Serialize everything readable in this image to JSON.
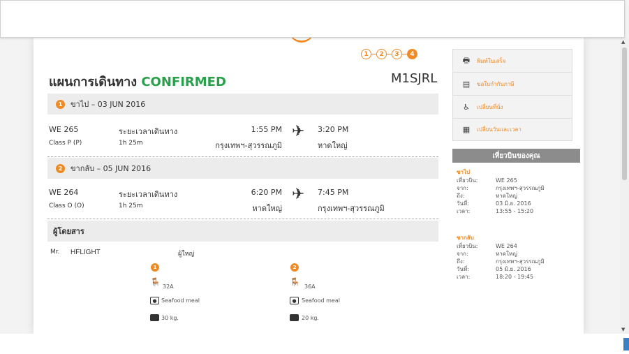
{
  "steps": [
    "1",
    "2",
    "3",
    "4"
  ],
  "header": {
    "title_prefix": "แผนการเดินทาง",
    "title_status": "CONFIRMED",
    "pnr": "M1SJRL"
  },
  "outbound": {
    "number": "1",
    "heading": "ขาไป – 03 JUN 2016",
    "flight": "WE 265",
    "class": "Class P (P)",
    "duration_label": "ระยะเวลาเดินทาง",
    "duration": "1h 25m",
    "depart_time": "1:55 PM",
    "depart_city": "กรุงเทพฯ-สุวรรณภูมิ",
    "arrive_time": "3:20 PM",
    "arrive_city": "หาดใหญ่"
  },
  "return": {
    "number": "2",
    "heading": "ขากลับ – 05 JUN 2016",
    "flight": "WE 264",
    "class": "Class O (O)",
    "duration_label": "ระยะเวลาเดินทาง",
    "duration": "1h 25m",
    "depart_time": "6:20 PM",
    "depart_city": "หาดใหญ่",
    "arrive_time": "7:45 PM",
    "arrive_city": "กรุงเทพฯ-สุวรรณภูมิ"
  },
  "passengers": {
    "heading": "ผู้โดยสาร",
    "list": [
      {
        "title": "Mr.",
        "name": "HFLIGHT",
        "type": "ผู้ใหญ่",
        "segments": [
          {
            "num": "1",
            "seat": "32A",
            "meal": "Seafood meal",
            "baggage": "30 kg."
          },
          {
            "num": "2",
            "seat": "36A",
            "meal": "Seafood meal",
            "baggage": "20 kg."
          }
        ]
      }
    ]
  },
  "menu": [
    {
      "icon": "printer-icon",
      "label": "พิมพ์ใบเสร็จ"
    },
    {
      "icon": "receipt-icon",
      "label": "ขอใบกำกับภาษี"
    },
    {
      "icon": "seat-icon",
      "label": "เปลี่ยนที่นั่ง"
    },
    {
      "icon": "calendar-icon",
      "label": "เปลี่ยนวันและเวลา"
    }
  ],
  "your_trip": {
    "heading": "เที่ยวบินของคุณ",
    "labels": {
      "flight": "เที่ยวบิน:",
      "from": "จาก:",
      "to": "ถึง:",
      "date": "วันที่:",
      "time": "เวลา:"
    },
    "outbound": {
      "heading": "ขาไป",
      "flight": "WE 265",
      "from": "กรุงเทพฯ-สุวรรณภูมิ",
      "to": "หาดใหญ่",
      "date": "03 มิ.ย. 2016",
      "time": "13:55 - 15:20"
    },
    "return": {
      "heading": "ขากลับ",
      "flight": "WE 264",
      "from": "หาดใหญ่",
      "to": "กรุงเทพฯ-สุวรรณภูมิ",
      "date": "05 มิ.ย. 2016",
      "time": "18:20 - 19:45"
    }
  },
  "colors": {
    "accent": "#f08a24",
    "confirmed": "#27a14a",
    "sidebar_header": "#8c8c8c"
  }
}
